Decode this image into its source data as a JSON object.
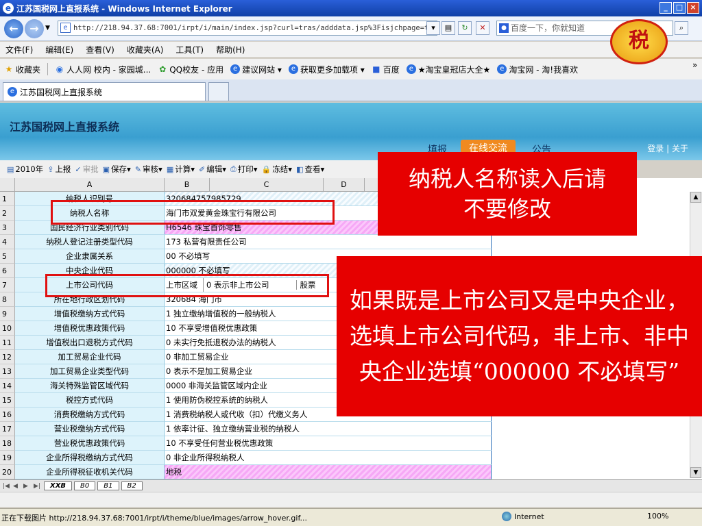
{
  "window": {
    "title": "江苏国税网上直报系统 - Windows Internet Explorer"
  },
  "address": {
    "url": "http://218.94.37.68:7001/irpt/i/main/index.jsp?curl=tras/adddata.jsp%3Fisjchpage=true",
    "search_placeholder": "百度一下，你就知道"
  },
  "menu": [
    "文件(F)",
    "编辑(E)",
    "查看(V)",
    "收藏夹(A)",
    "工具(T)",
    "帮助(H)"
  ],
  "favorites": {
    "label": "收藏夹",
    "items": [
      "人人网 校内 - 家园城...",
      "QQ校友 - 应用",
      "建议网站 ▾",
      "获取更多加载项 ▾",
      "百度",
      "★淘宝皇冠店大全★",
      "淘宝网 - 淘!我喜欢"
    ]
  },
  "tabs": {
    "active": "江苏国税网上直报系统"
  },
  "app": {
    "title": "江苏国税网上直报系统",
    "nav": [
      "填报",
      "在线交流",
      "公告"
    ],
    "links": [
      "登录",
      "关于"
    ]
  },
  "toolbar": {
    "year": "2010年",
    "buttons": [
      "上报",
      "审批",
      "保存▾",
      "审核▾",
      "计算▾",
      "编辑▾",
      "打印▾",
      "冻结▾",
      "查看▾"
    ]
  },
  "grid": {
    "columns": [
      "A",
      "B",
      "C",
      "D"
    ],
    "rows": [
      {
        "n": "1",
        "label": "纳税人识别号",
        "value": "320684757985729"
      },
      {
        "n": "2",
        "label": "纳税人名称",
        "value": "海门市双爱黄金珠宝行有限公司"
      },
      {
        "n": "3",
        "label": "国民经济行业类别代码",
        "value": "H6546 珠宝首饰零售"
      },
      {
        "n": "4",
        "label": "纳税人登记注册类型代码",
        "value": "173 私营有限责任公司"
      },
      {
        "n": "5",
        "label": "企业隶属关系",
        "value": "00 不必填写"
      },
      {
        "n": "6",
        "label": "中央企业代码",
        "value": "000000 不必填写"
      },
      {
        "n": "7",
        "label": "上市公司代码",
        "sub": "上市区域",
        "value": "0 表示非上市公司",
        "extra": "股票"
      },
      {
        "n": "8",
        "label": "所在地行政区划代码",
        "value": "320684 海门市"
      },
      {
        "n": "9",
        "label": "增值税缴纳方式代码",
        "value": "1 独立缴纳增值税的一般纳税人"
      },
      {
        "n": "10",
        "label": "增值税优惠政策代码",
        "value": "10 不享受增值税优惠政策"
      },
      {
        "n": "11",
        "label": "增值税出口退税方式代码",
        "value": "0 未实行免抵退税办法的纳税人"
      },
      {
        "n": "12",
        "label": "加工贸易企业代码",
        "value": "0 非加工贸易企业"
      },
      {
        "n": "13",
        "label": "加工贸易企业类型代码",
        "value": "0 表示不是加工贸易企业"
      },
      {
        "n": "14",
        "label": "海关特殊监管区域代码",
        "value": "0000 非海关监管区域内企业"
      },
      {
        "n": "15",
        "label": "税控方式代码",
        "value": "1 使用防伪税控系统的纳税人"
      },
      {
        "n": "16",
        "label": "消费税缴纳方式代码",
        "value": "1 消费税纳税人或代收（扣）代缴义务人"
      },
      {
        "n": "17",
        "label": "营业税缴纳方式代码",
        "value": "1 依率计征、独立缴纳营业税的纳税人"
      },
      {
        "n": "18",
        "label": "营业税优惠政策代码",
        "value": "10 不享受任何营业税优惠政策"
      },
      {
        "n": "19",
        "label": "企业所得税缴纳方式代码",
        "value": "0 非企业所得税纳税人"
      },
      {
        "n": "20",
        "label": "企业所得税征收机关代码",
        "value": "地税"
      }
    ]
  },
  "sheets": [
    "XXB",
    "B0",
    "B1",
    "B2"
  ],
  "callouts": {
    "c1": "纳税人名称读入后请不要修改",
    "c2": "如果既是上市公司又是中央企业，选填上市公司代码，非上市、非中央企业选填“000000 不必填写”"
  },
  "status": {
    "text": "正在下载图片 http://218.94.37.68:7001/irpt/i/theme/blue/images/arrow_hover.gif...",
    "zone": "Internet",
    "zoom": "100%"
  }
}
